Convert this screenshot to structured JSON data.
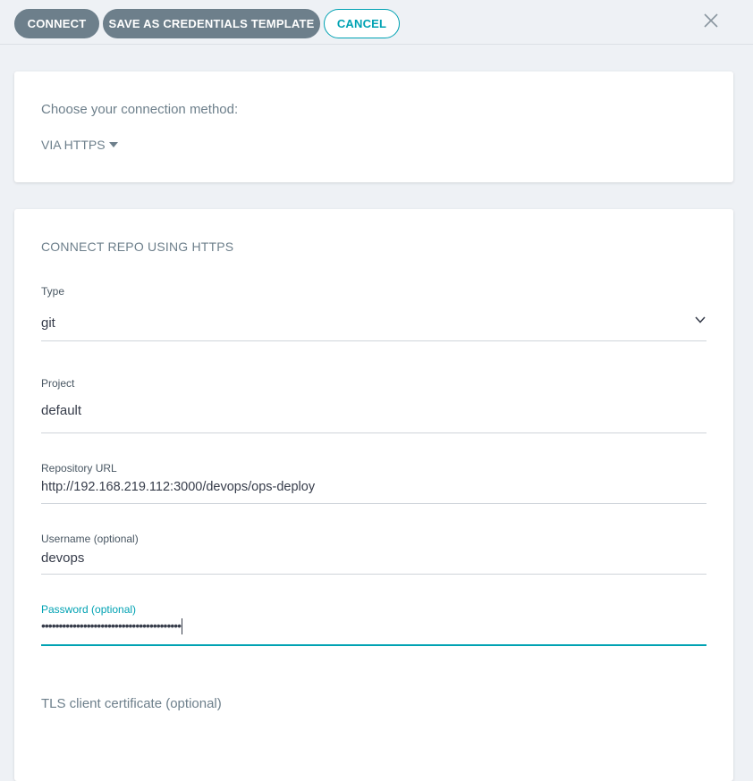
{
  "toolbar": {
    "connect_label": "CONNECT",
    "save_template_label": "SAVE AS CREDENTIALS TEMPLATE",
    "cancel_label": "CANCEL",
    "close_icon": "close-icon"
  },
  "method_card": {
    "prompt": "Choose your connection method:",
    "selected_method": "VIA HTTPS"
  },
  "form": {
    "section_title": "CONNECT REPO USING HTTPS",
    "type": {
      "label": "Type",
      "value": "git"
    },
    "project": {
      "label": "Project",
      "value": "default"
    },
    "repo_url": {
      "label": "Repository URL",
      "value": "http://192.168.219.112:3000/devops/ops-deploy"
    },
    "username": {
      "label": "Username (optional)",
      "value": "devops"
    },
    "password": {
      "label": "Password (optional)",
      "value": "••••••••••••••••••••••••••••••••••••••••"
    },
    "tls_title": "TLS client certificate (optional)"
  },
  "colors": {
    "accent": "#00a2b3",
    "button_dark": "#6d7f8b",
    "background": "#eef1f5"
  }
}
